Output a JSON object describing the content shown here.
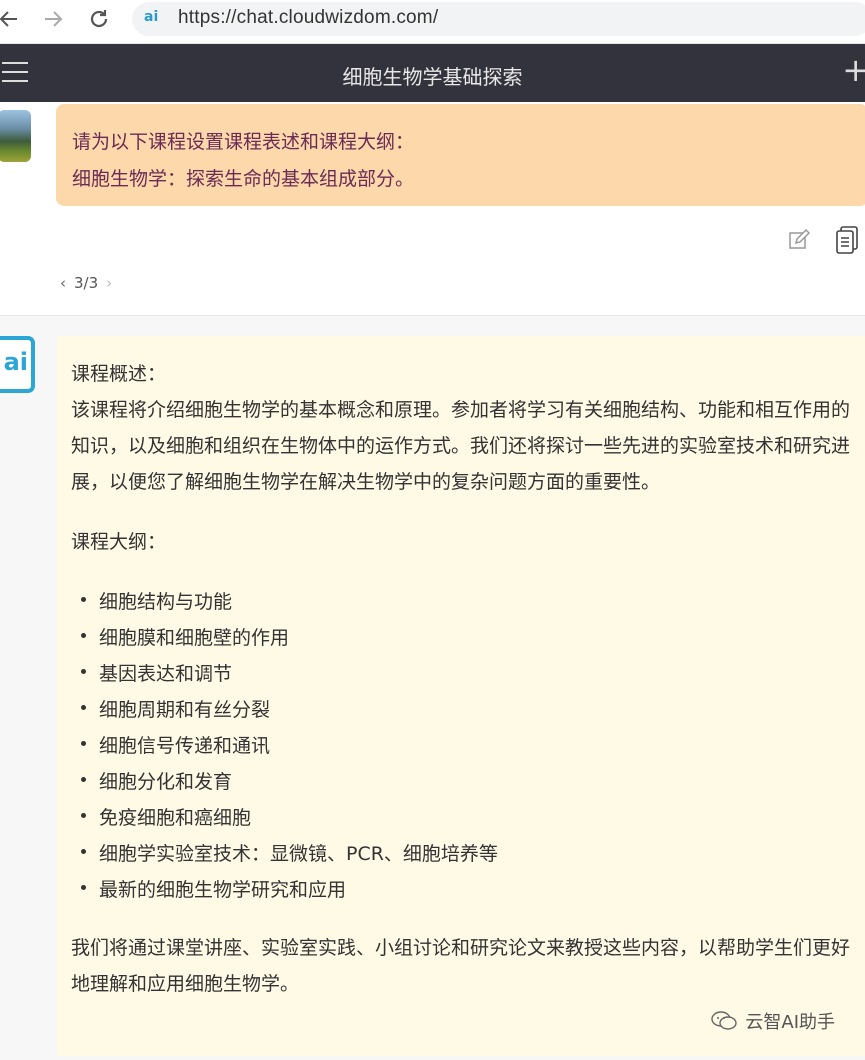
{
  "browser": {
    "url": "https://chat.cloudwizdom.com/",
    "site_icon_text": "ai"
  },
  "header": {
    "title": "细胞生物学基础探索"
  },
  "user_message": {
    "lines": [
      "请为以下课程设置课程表述和课程大纲：",
      "细胞生物学：探索生命的基本组成部分。"
    ]
  },
  "pager": {
    "text": "3/3",
    "prev": "‹",
    "next": "›"
  },
  "bot": {
    "avatar_text": "ai",
    "overview_heading": "课程概述：",
    "overview_body": "该课程将介绍细胞生物学的基本概念和原理。参加者将学习有关细胞结构、功能和相互作用的知识，以及细胞和组织在生物体中的运作方式。我们还将探讨一些先进的实验室技术和研究进展，以便您了解细胞生物学在解决生物学中的复杂问题方面的重要性。",
    "syllabus_heading": "课程大纲：",
    "syllabus_items": [
      "细胞结构与功能",
      "细胞膜和细胞壁的作用",
      "基因表达和调节",
      "细胞周期和有丝分裂",
      "细胞信号传递和通讯",
      "细胞分化和发育",
      "免疫细胞和癌细胞",
      "细胞学实验室技术：显微镜、PCR、细胞培养等",
      "最新的细胞生物学研究和应用"
    ],
    "closing": "我们将通过课堂讲座、实验室实践、小组讨论和研究论文来教授这些内容，以帮助学生们更好地理解和应用细胞生物学。"
  },
  "watermark": {
    "text": "云智AI助手"
  },
  "colors": {
    "header_bg": "#33333d",
    "user_bubble": "#fdd8aa",
    "user_text": "#6b2b55",
    "bot_bubble": "#fffae6",
    "brand": "#2ba6d6"
  }
}
